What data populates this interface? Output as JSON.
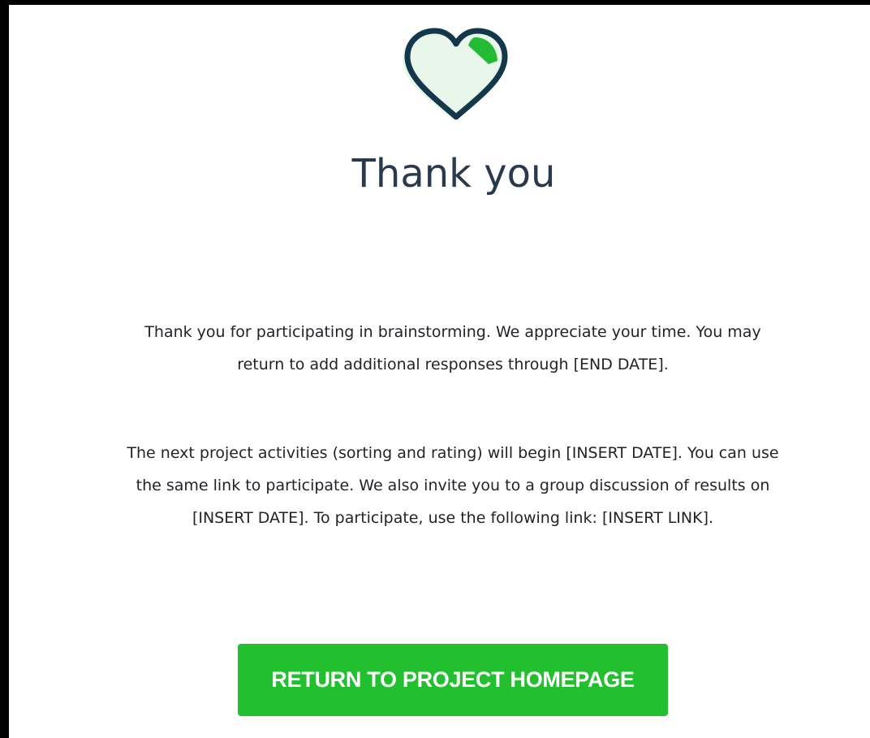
{
  "heading": "Thank you",
  "paragraph_1": "Thank you for participating in brainstorming. We appreciate your time. You may return to add additional responses through [END DATE].",
  "paragraph_2_line_1": "The next project activities (sorting and rating) will begin [INSERT DATE]. You can use",
  "paragraph_2_line_2": "the same link to participate. We also invite you to a group discussion of results on",
  "paragraph_2_line_3": "[INSERT DATE]. To participate, use the following link: [INSERT LINK].",
  "paragraph_1_line_1": "Thank you for participating in brainstorming. We appreciate your time. You may",
  "paragraph_1_line_2": "return to add additional responses through [END DATE].",
  "cta_label": "RETURN TO PROJECT HOMEPAGE",
  "logo": {
    "icon": "heart-logo-icon",
    "outline_color": "#13384c",
    "accent_color": "#23bb33"
  },
  "colors": {
    "button": "#22c02e",
    "button_text": "#ffffff",
    "heading": "#2a3a4e",
    "body_text": "#1f2328"
  }
}
